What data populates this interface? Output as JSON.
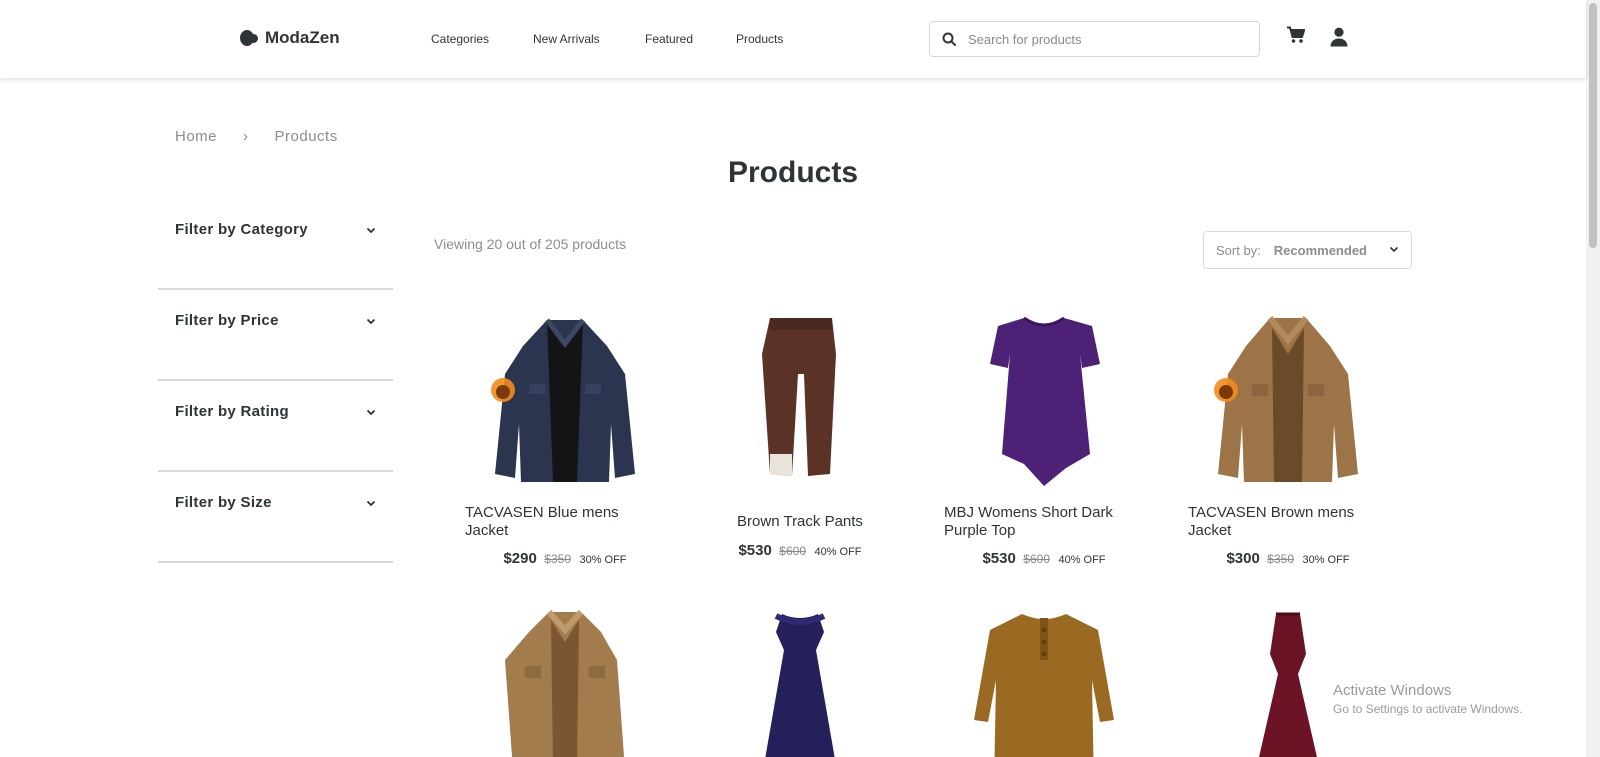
{
  "brand": {
    "name": "ModaZen"
  },
  "nav": {
    "items": [
      "Categories",
      "New Arrivals",
      "Featured",
      "Products"
    ]
  },
  "search": {
    "placeholder": "Search for products"
  },
  "breadcrumb": {
    "home": "Home",
    "separator": "›",
    "current": "Products"
  },
  "page": {
    "title": "Products",
    "viewing_text": "Viewing 20 out of 205 products"
  },
  "filters": [
    "Filter by Category",
    "Filter by Price",
    "Filter by Rating",
    "Filter by Size"
  ],
  "sort": {
    "label": "Sort by:",
    "value": "Recommended"
  },
  "products": [
    {
      "name": "TACVASEN Blue mens Jacket",
      "price": "$290",
      "old_price": "$350",
      "discount": "30% OFF",
      "image": "navy-jacket"
    },
    {
      "name": "Brown Track Pants",
      "price": "$530",
      "old_price": "$600",
      "discount": "40% OFF",
      "image": "brown-pants"
    },
    {
      "name": "MBJ Womens Short Dark Purple Top",
      "price": "$530",
      "old_price": "$600",
      "discount": "40% OFF",
      "image": "purple-top"
    },
    {
      "name": "TACVASEN Brown mens Jacket",
      "price": "$300",
      "old_price": "$350",
      "discount": "30% OFF",
      "image": "tan-jacket"
    },
    {
      "name": "",
      "image": "tan-jacket-2"
    },
    {
      "name": "",
      "image": "navy-dress"
    },
    {
      "name": "",
      "image": "mustard-henley"
    },
    {
      "name": "",
      "image": "burgundy-dress"
    }
  ],
  "watermark": {
    "title": "Activate Windows",
    "subtitle": "Go to Settings to activate Windows."
  },
  "colors": {
    "text": "#2f3437",
    "muted": "#8d8d8d",
    "divider": "#d7d7d7"
  }
}
